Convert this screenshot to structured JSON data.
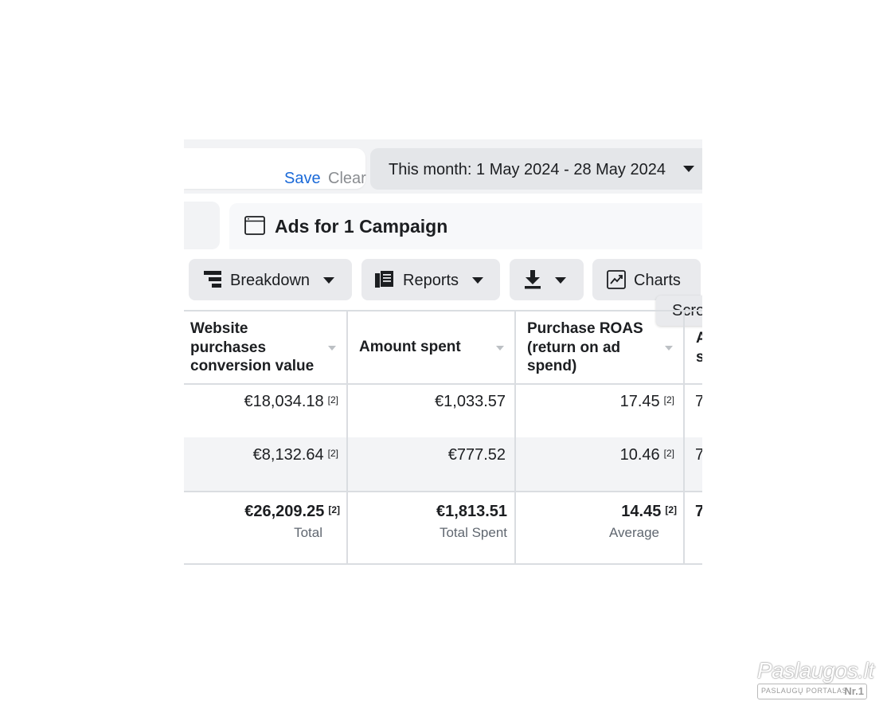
{
  "filter_bar": {
    "save_label": "Save",
    "clear_label": "Clear",
    "date_range": "This month: 1 May 2024 - 28 May 2024"
  },
  "level": {
    "title": "Ads for 1 Campaign"
  },
  "toolbar": {
    "breakdown_label": "Breakdown",
    "reports_label": "Reports",
    "charts_label": "Charts",
    "tooltip_label": "Scre"
  },
  "table": {
    "columns": [
      {
        "header_lines": [
          "Website",
          "purchases",
          "conversion value"
        ]
      },
      {
        "header_lines": [
          "Amount spent"
        ]
      },
      {
        "header_lines": [
          "Purchase ROAS",
          "(return on ad",
          "spend)"
        ]
      },
      {
        "header_lines": [
          "A",
          "s"
        ]
      }
    ],
    "rows": [
      {
        "conversion_value": "€18,034.18",
        "conversion_note": "[2]",
        "amount_spent": "€1,033.57",
        "roas": "17.45",
        "roas_note": "[2]",
        "cut": "7"
      },
      {
        "conversion_value": "€8,132.64",
        "conversion_note": "[2]",
        "amount_spent": "€777.52",
        "roas": "10.46",
        "roas_note": "[2]",
        "cut": "7"
      }
    ],
    "totals": {
      "conversion_value": "€26,209.25",
      "conversion_note": "[2]",
      "conversion_caption": "Total",
      "amount_spent": "€1,813.51",
      "amount_caption": "Total Spent",
      "roas": "14.45",
      "roas_note": "[2]",
      "roas_caption": "Average",
      "cut": "7"
    }
  },
  "watermark": {
    "brand": "Paslaugos.lt",
    "tagline": "PASLAUGŲ PORTALAS",
    "rank": "Nr.1"
  },
  "colors": {
    "link": "#1b6ad8",
    "button_bg": "#e9eaed",
    "row_stripe": "#f3f4f6",
    "grid_line": "#dadde1"
  }
}
